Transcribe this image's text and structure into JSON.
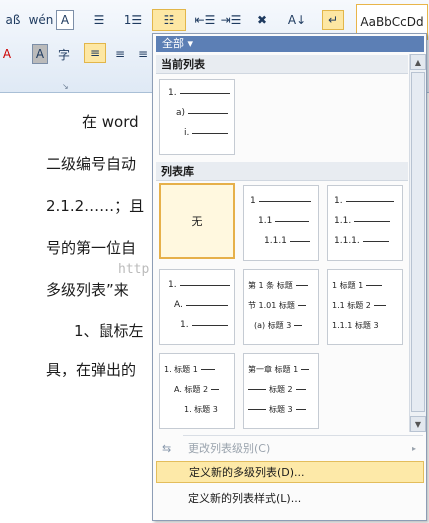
{
  "ribbon": {
    "row1": {
      "b1": "aß",
      "b2": "wén",
      "b3": "A",
      "b4": "☰",
      "b5": "1☰",
      "b6": "☷",
      "b7": "⇤☰",
      "b8": "⇥☰",
      "b9": "✖",
      "b10": "A↓",
      "b11": "↵"
    },
    "row2": {
      "b1": "A",
      "b2": "A",
      "b3": "字",
      "b4": "≡",
      "b5": "≡",
      "b6": "≡"
    },
    "launcher": "↘",
    "style_preview": "AaBbCcDd"
  },
  "document": {
    "lines": [
      "在 word",
      "二级编号自动",
      "2.1.2……；且",
      "号的第一位自",
      "多级列表”来",
      "1、鼠标左",
      "具，在弹出的"
    ],
    "watermark": "http://blog.csdn.net/"
  },
  "dropdown": {
    "filter_label": "全部",
    "filter_arrow": "▾",
    "current_section": "当前列表",
    "library_section": "列表库",
    "current_tile": [
      "1.",
      "a)",
      "i."
    ],
    "none_label": "无",
    "tiles": [
      [
        "1",
        "1.1",
        "1.1.1"
      ],
      [
        "1.",
        "1.1.",
        "1.1.1."
      ],
      [
        "1.",
        "A.",
        "1."
      ],
      [
        "第 1 条 标题",
        "节 1.01 标题",
        "(a) 标题 3"
      ],
      [
        "1 标题 1",
        "1.1 标题 2",
        "1.1.1 标题 3"
      ],
      [
        "1. 标题 1",
        "A. 标题 2",
        "1. 标题 3"
      ],
      [
        "第一章 标题 1",
        "标题 2",
        "标题 3"
      ]
    ],
    "menu_items": {
      "change_level": "更改列表级别(C)",
      "define_multilevel": "定义新的多级列表(D)...",
      "define_style": "定义新的列表样式(L)..."
    },
    "scroll": {
      "up": "▲",
      "down": "▼",
      "more": "▼"
    },
    "submenu_arrow": "▸"
  }
}
